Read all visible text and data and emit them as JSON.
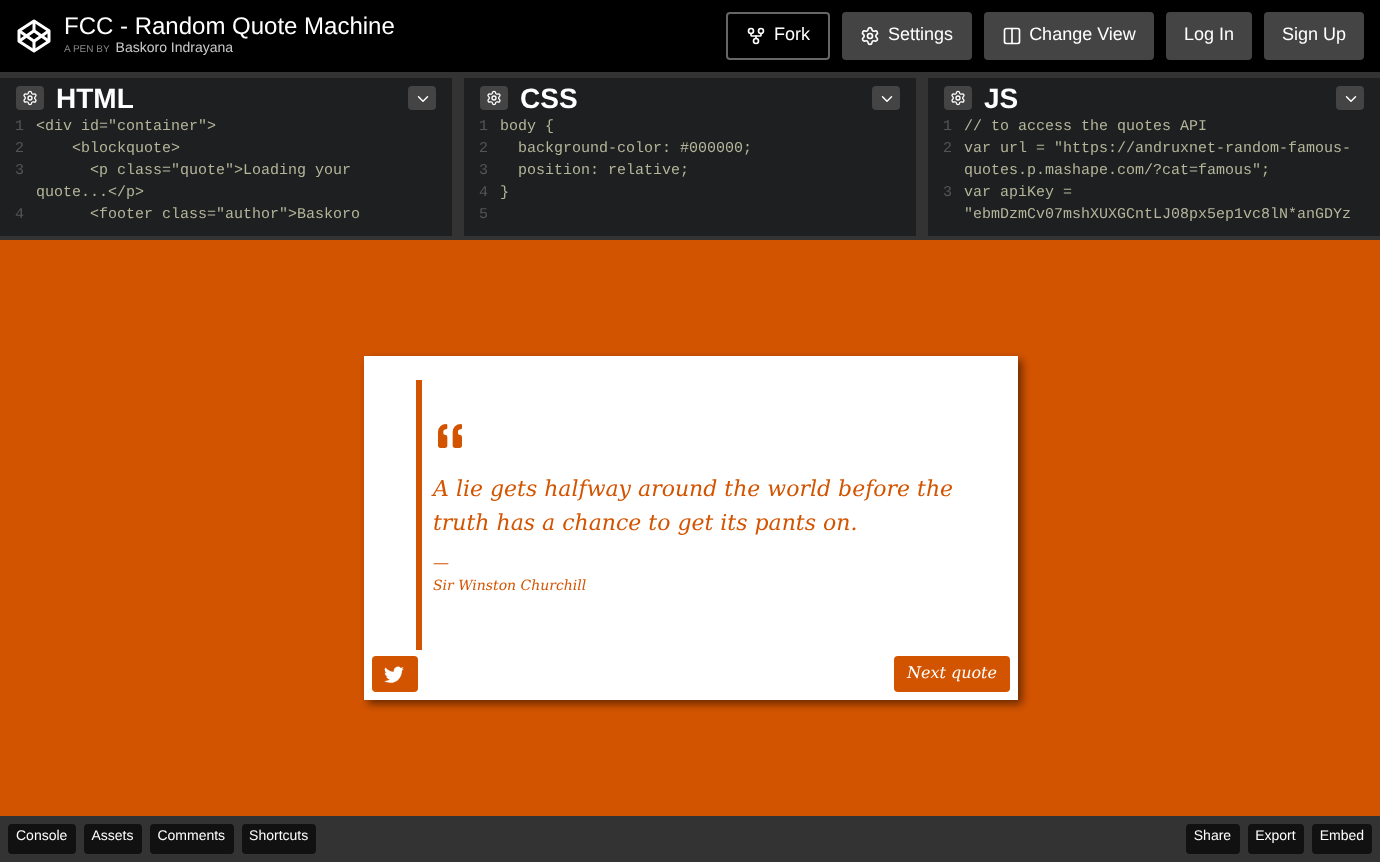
{
  "header": {
    "title": "FCC - Random Quote Machine",
    "byline_prefix": "A PEN BY",
    "author": "Baskoro Indrayana",
    "buttons": [
      {
        "label": "Fork",
        "kind": "fork"
      },
      {
        "label": "Settings",
        "kind": "settings"
      },
      {
        "label": "Change View",
        "kind": "view"
      },
      {
        "label": "Log In",
        "kind": "plain"
      },
      {
        "label": "Sign Up",
        "kind": "plain"
      }
    ]
  },
  "editors": [
    {
      "title": "HTML",
      "lines": [
        {
          "number": "1",
          "text": "<div id=\"container\">"
        },
        {
          "number": "2",
          "text": "    <blockquote>"
        },
        {
          "number": "3",
          "text": "      <p class=\"quote\">Loading your"
        },
        {
          "text": "quote...</p>"
        },
        {
          "number": "4",
          "text": "      <footer class=\"author\">Baskoro"
        }
      ]
    },
    {
      "title": "CSS",
      "lines": [
        {
          "number": "1",
          "text": "body {"
        },
        {
          "number": "2",
          "text": "  background-color: #000000;"
        },
        {
          "number": "3",
          "text": "  position: relative;"
        },
        {
          "number": "4",
          "text": "}"
        },
        {
          "number": "5"
        }
      ]
    },
    {
      "title": "JS",
      "lines": [
        {
          "number": "1",
          "text": "// to access the quotes API"
        },
        {
          "number": "2",
          "text": "var url = \"https://andruxnet-random-famous-"
        },
        {
          "text": "quotes.p.mashape.com/?cat=famous\";"
        },
        {
          "number": "3",
          "text": "var apiKey ="
        },
        {
          "text": "\"ebmDzmCv07mshXUXGCntLJ08px5ep1vc8lN*anGDYz"
        }
      ]
    }
  ],
  "quote": {
    "text": "A lie gets halfway around the world before the truth has a chance to get its pants on.",
    "dash": "—",
    "author": "Sir Winston Churchill",
    "next_button": "Next quote"
  },
  "footer": {
    "left": [
      "Console",
      "Assets",
      "Comments",
      "Shortcuts"
    ],
    "right": [
      "Share",
      "Export",
      "Embed"
    ]
  }
}
